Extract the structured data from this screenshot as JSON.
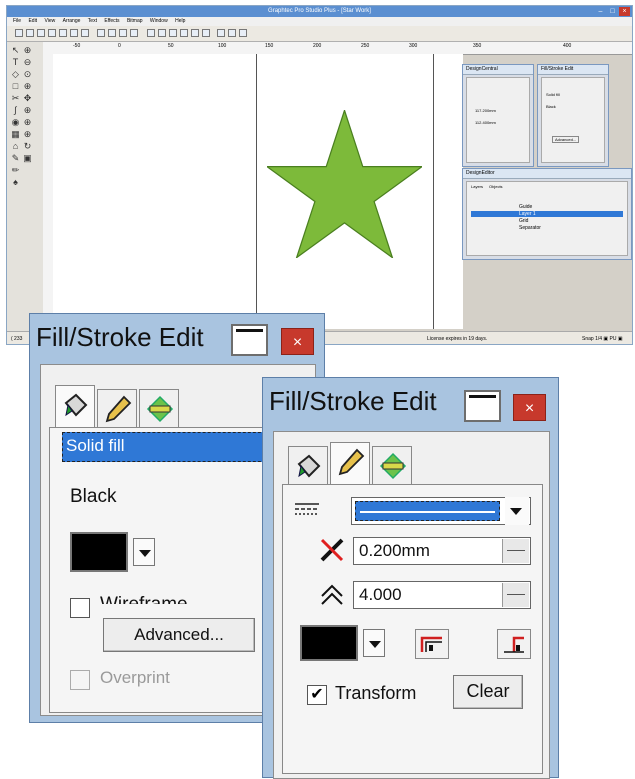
{
  "app": {
    "title": "Graphtec Pro Studio Plus - [Star Work]",
    "menu": [
      "File",
      "Edit",
      "View",
      "Arrange",
      "Text",
      "Effects",
      "Bitmap",
      "Window",
      "Help"
    ],
    "ruler_ticks": [
      "-50",
      "0",
      "50",
      "100",
      "150",
      "200",
      "250",
      "300",
      "350",
      "400"
    ],
    "status_left": "( 233",
    "status_mid": "License expires in 19 days.",
    "status_right": "Snap 1/4 ▣ PU ▣"
  },
  "design_central": {
    "title": "DesignCentral",
    "value1": "117.200mm",
    "value2": "112.400mm"
  },
  "mini_fill_stroke": {
    "title": "Fill/Stroke Edit",
    "fill": "Solid fill",
    "color": "Black",
    "advanced": "Advanced..."
  },
  "design_editor": {
    "title": "DesignEditor",
    "tabs": [
      "Layers",
      "Objects"
    ],
    "layers": [
      "Guide",
      "Layer 1",
      "Grid",
      "Separator"
    ]
  },
  "dialog_fill": {
    "title": "Fill/Stroke Edit",
    "close": "×",
    "fill_type": "Solid fill",
    "color_name": "Black",
    "wireframe_label": "Wireframe",
    "advanced_label": "Advanced...",
    "overprint_label": "Overprint"
  },
  "dialog_stroke": {
    "title": "Fill/Stroke Edit",
    "close": "×",
    "width_value": "0.200mm",
    "miter_value": "4.000",
    "transform_label": "Transform",
    "transform_checked": "✔",
    "clear_label": "Clear"
  },
  "icons": {
    "fill_tab": "paint-bucket-icon",
    "stroke_tab": "pencil-icon",
    "effects_tab": "green-shape-icon"
  },
  "colors": {
    "star": "#7dba3a",
    "titlebar": "#5b8fd1",
    "dialog_frame": "#a9c4e0",
    "selection": "#2f78d6",
    "close": "#c7392c"
  }
}
